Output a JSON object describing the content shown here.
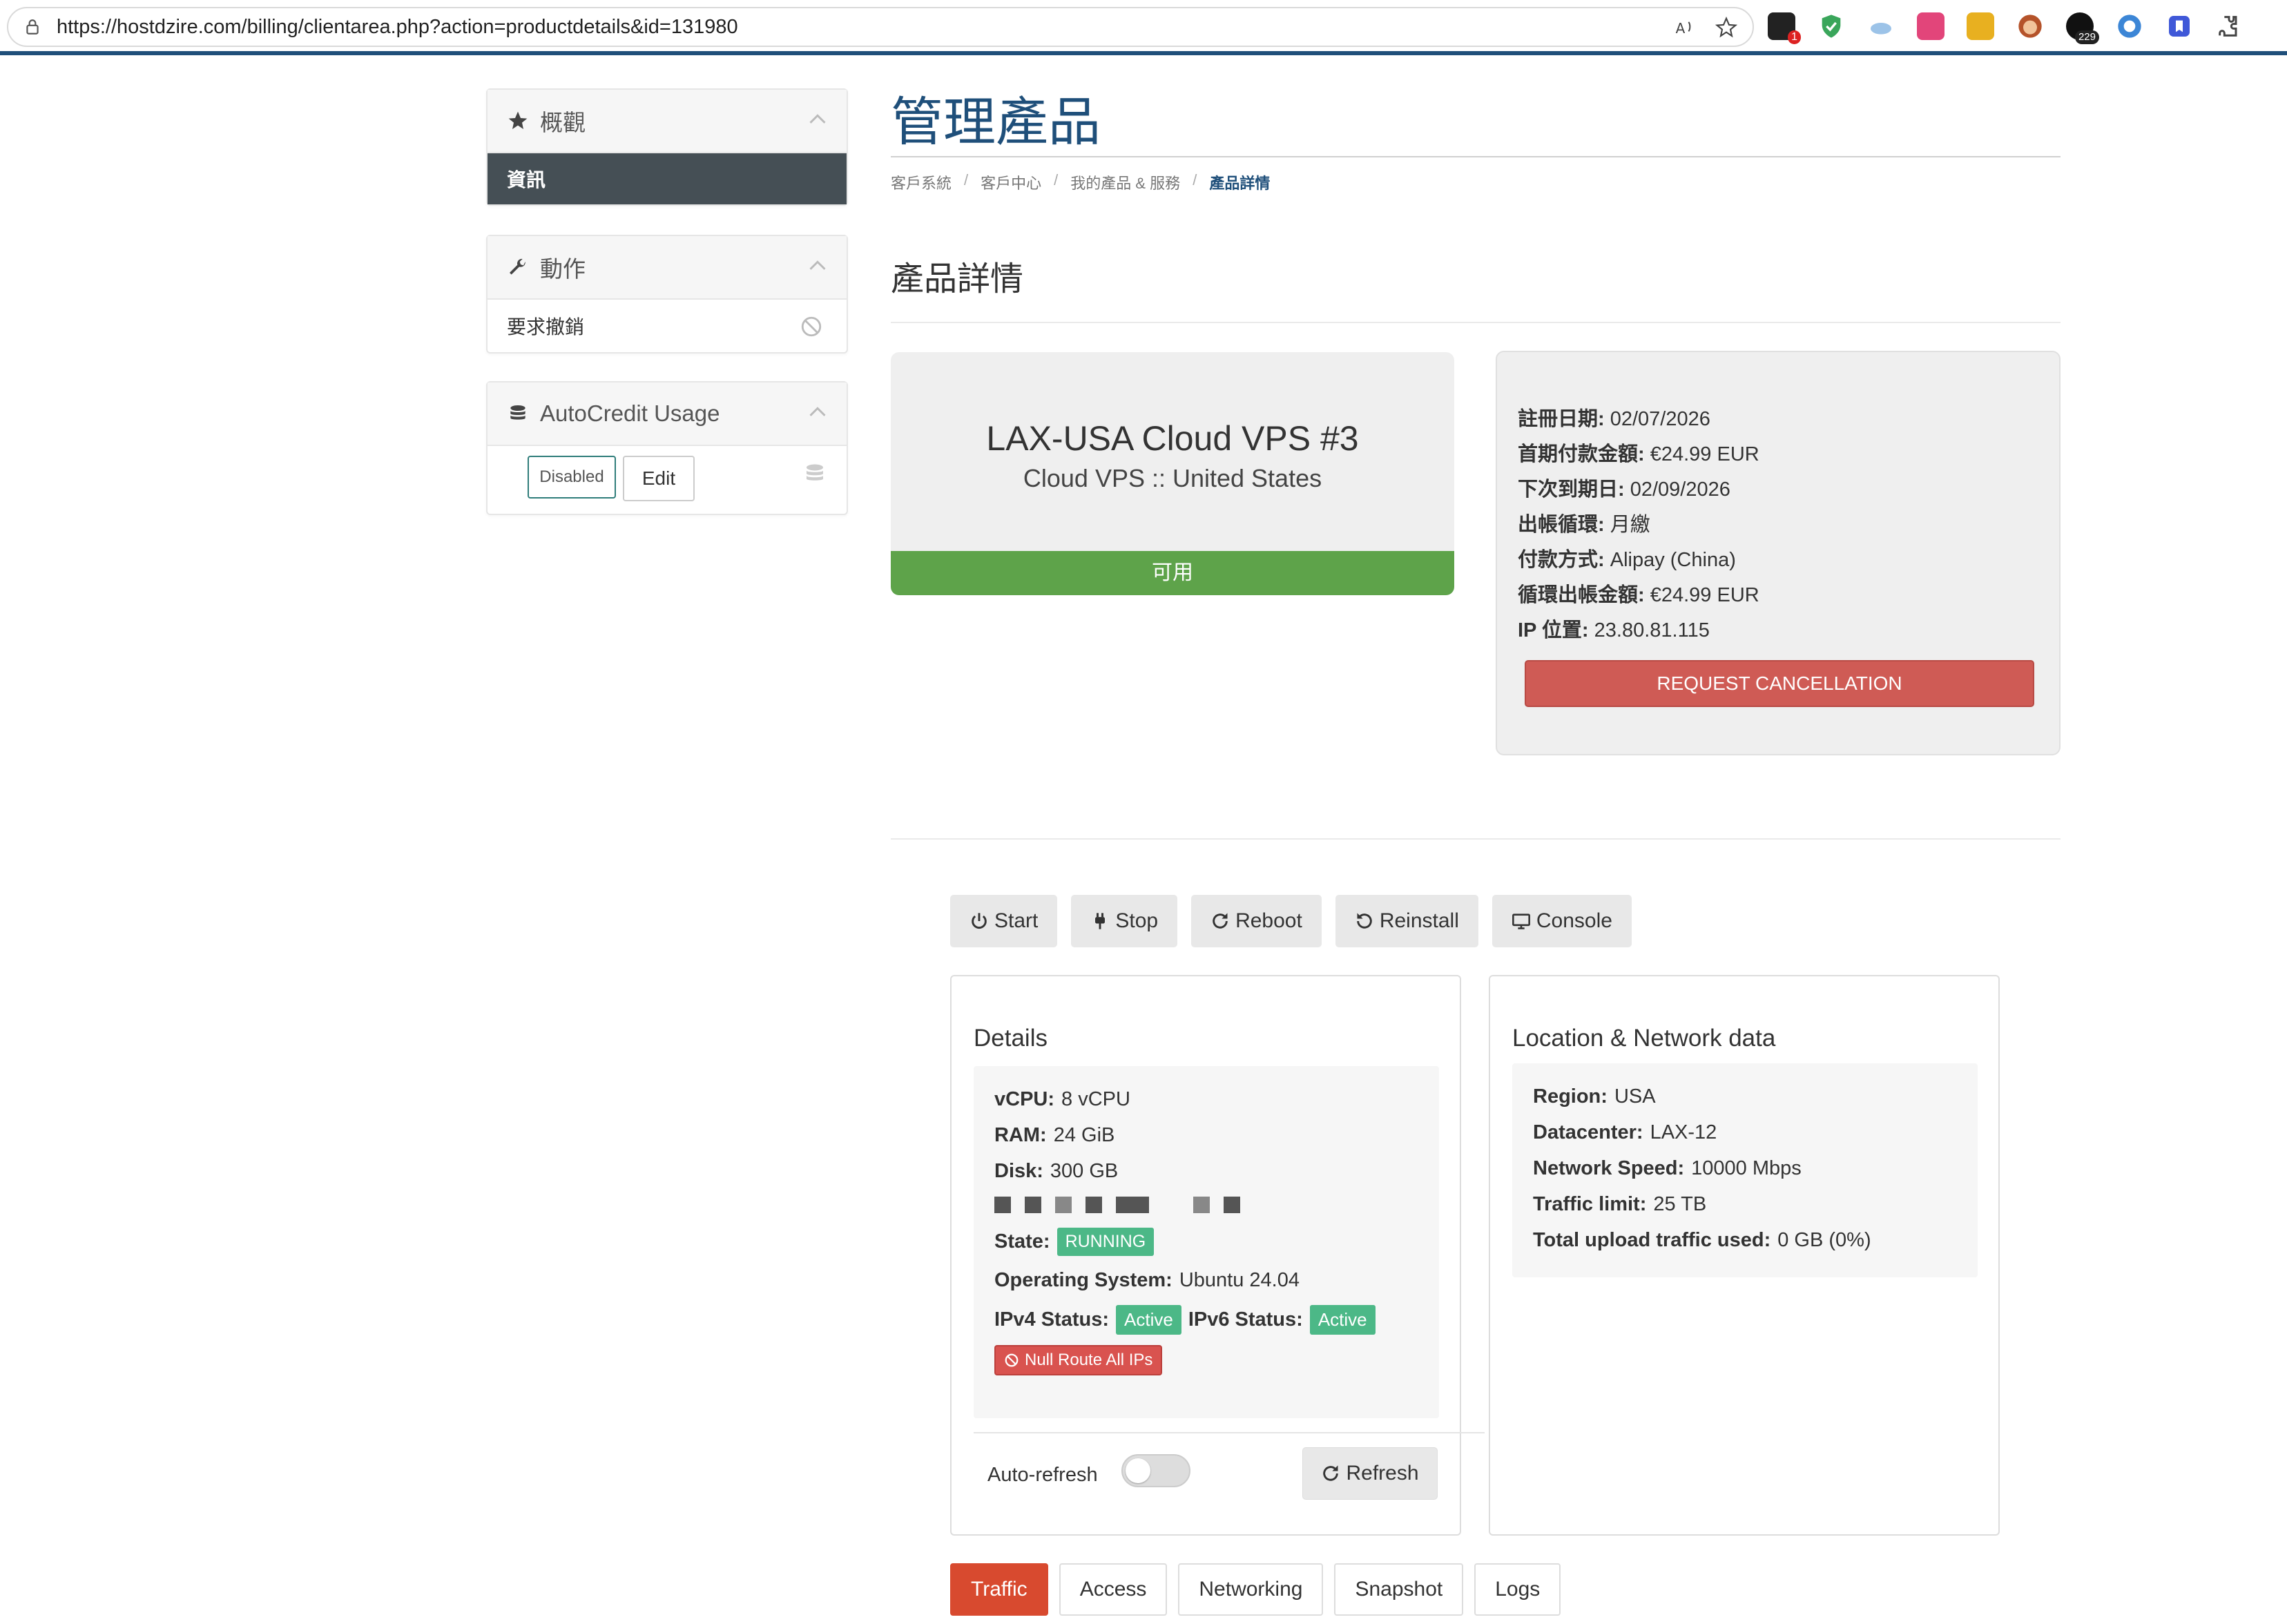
{
  "browser": {
    "url": "https://hostdzire.com/billing/clientarea.php?action=productdetails&id=131980",
    "ext_badges": {
      "mail": "1",
      "counter": "229"
    }
  },
  "sidebar": {
    "overview": {
      "title": "概觀",
      "active_item": "資訊"
    },
    "actions": {
      "title": "動作",
      "cancel_item": "要求撤銷"
    },
    "autocredit": {
      "title": "AutoCredit Usage",
      "disabled_label": "Disabled",
      "edit_label": "Edit"
    }
  },
  "page": {
    "title": "管理產品",
    "breadcrumb": [
      "客戶系統",
      "客戶中心",
      "我的產品 & 服務",
      "產品詳情"
    ],
    "section_title": "產品詳情"
  },
  "product": {
    "name": "LAX-USA Cloud VPS #3",
    "subtitle": "Cloud VPS :: United States",
    "status": "可用"
  },
  "billing_info": {
    "items": [
      {
        "label": "註冊日期:",
        "value": "02/07/2026"
      },
      {
        "label": "首期付款金額:",
        "value": "€24.99 EUR"
      },
      {
        "label": "下次到期日:",
        "value": "02/09/2026"
      },
      {
        "label": "出帳循環:",
        "value": "月繳"
      },
      {
        "label": "付款方式:",
        "value": "Alipay (China)"
      },
      {
        "label": "循環出帳金額:",
        "value": "€24.99 EUR"
      },
      {
        "label": "IP 位置:",
        "value": "23.80.81.115"
      }
    ],
    "cancel_button": "REQUEST CANCELLATION"
  },
  "actions": {
    "start": "Start",
    "stop": "Stop",
    "reboot": "Reboot",
    "reinstall": "Reinstall",
    "console": "Console"
  },
  "details": {
    "title": "Details",
    "vcpu": {
      "label": "vCPU:",
      "value": "8 vCPU"
    },
    "ram": {
      "label": "RAM:",
      "value": "24 GiB"
    },
    "disk": {
      "label": "Disk:",
      "value": "300 GB"
    },
    "state": {
      "label": "State:",
      "value": "RUNNING"
    },
    "os": {
      "label": "Operating System:",
      "value": "Ubuntu 24.04"
    },
    "ipv4": {
      "label": "IPv4 Status:",
      "value": "Active"
    },
    "ipv6": {
      "label": "IPv6 Status:",
      "value": "Active"
    },
    "null_route": "Null Route All IPs",
    "auto_refresh": "Auto-refresh",
    "auto_refresh_on": false,
    "refresh": "Refresh"
  },
  "location": {
    "title": "Location & Network data",
    "region": {
      "label": "Region:",
      "value": "USA"
    },
    "datacenter": {
      "label": "Datacenter:",
      "value": "LAX-12"
    },
    "speed": {
      "label": "Network Speed:",
      "value": "10000 Mbps"
    },
    "traffic_limit": {
      "label": "Traffic limit:",
      "value": "25 TB"
    },
    "upload": {
      "label": "Total upload traffic used:",
      "value": "0 GB (0%)"
    }
  },
  "tabs": [
    {
      "label": "Traffic",
      "active": true
    },
    {
      "label": "Access",
      "active": false
    },
    {
      "label": "Networking",
      "active": false
    },
    {
      "label": "Snapshot",
      "active": false
    },
    {
      "label": "Logs",
      "active": false
    }
  ],
  "colors": {
    "brand": "#1f4f7a",
    "status_green": "#5ea34a",
    "badge_green": "#4cb887",
    "danger": "#cf5b55",
    "tab_active": "#d84a2f",
    "sidebar_active": "#454f55"
  },
  "icons": {
    "overview": "star-icon",
    "actions": "wrench-icon",
    "autocredit": "coins-icon",
    "cancel": "ban-icon"
  }
}
